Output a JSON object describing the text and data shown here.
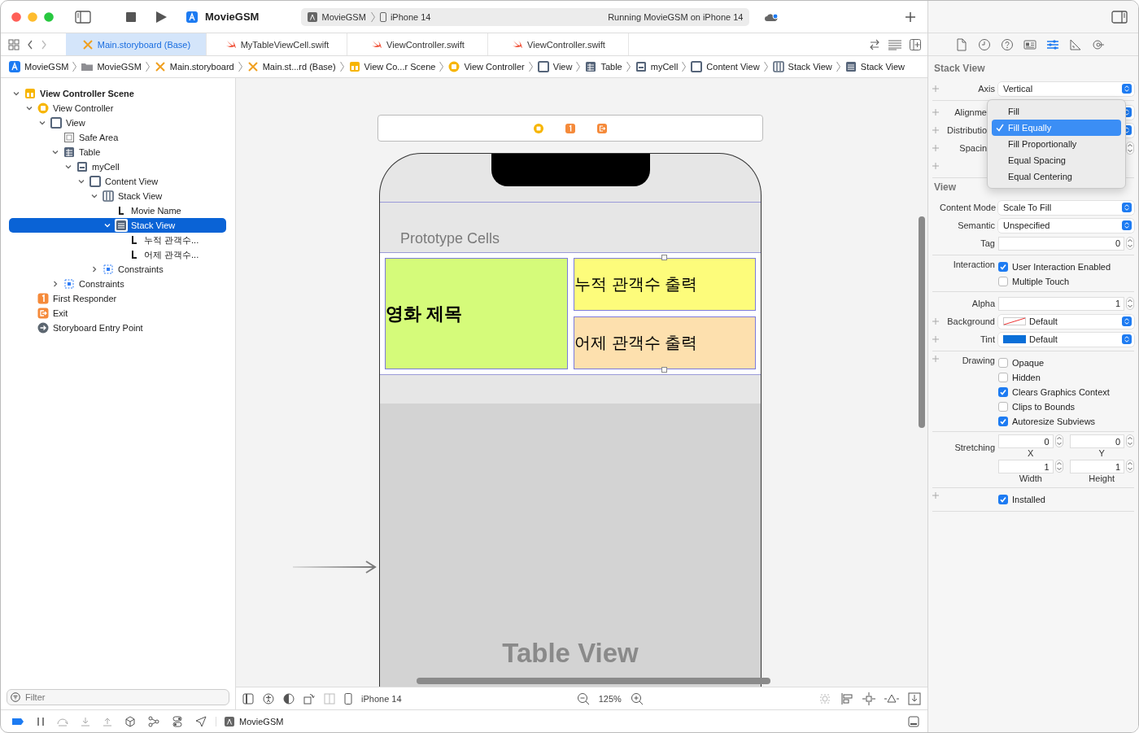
{
  "window": {
    "title": "MovieGSM"
  },
  "toolbar": {
    "scheme": "MovieGSM",
    "device": "iPhone 14",
    "status": "Running MovieGSM on iPhone 14"
  },
  "tabs": [
    {
      "label": "Main.storyboard (Base)",
      "kind": "storyboard",
      "selected": true
    },
    {
      "label": "MyTableViewCell.swift",
      "kind": "swift",
      "selected": false
    },
    {
      "label": "ViewController.swift",
      "kind": "swift",
      "selected": false
    },
    {
      "label": "ViewController.swift",
      "kind": "swift",
      "selected": false
    }
  ],
  "breadcrumbs": [
    {
      "label": "MovieGSM",
      "kind": "app"
    },
    {
      "label": "MovieGSM",
      "kind": "folder"
    },
    {
      "label": "Main.storyboard",
      "kind": "storyboard"
    },
    {
      "label": "Main.st...rd (Base)",
      "kind": "storyboard"
    },
    {
      "label": "View Co...r Scene",
      "kind": "scene"
    },
    {
      "label": "View Controller",
      "kind": "vc"
    },
    {
      "label": "View",
      "kind": "view"
    },
    {
      "label": "Table",
      "kind": "table"
    },
    {
      "label": "myCell",
      "kind": "cell"
    },
    {
      "label": "Content View",
      "kind": "view"
    },
    {
      "label": "Stack View",
      "kind": "stackh"
    },
    {
      "label": "Stack View",
      "kind": "stackv"
    }
  ],
  "outline": [
    {
      "label": "View Controller Scene",
      "kind": "scene",
      "expanded": true,
      "selected": false,
      "children": [
        {
          "label": "View Controller",
          "kind": "vc",
          "expanded": true,
          "selected": false,
          "children": [
            {
              "label": "View",
              "kind": "view",
              "expanded": true,
              "selected": false,
              "children": [
                {
                  "label": "Safe Area",
                  "kind": "safearea",
                  "selected": false
                },
                {
                  "label": "Table",
                  "kind": "table",
                  "expanded": true,
                  "selected": false,
                  "children": [
                    {
                      "label": "myCell",
                      "kind": "cell",
                      "expanded": true,
                      "selected": false,
                      "children": [
                        {
                          "label": "Content View",
                          "kind": "view",
                          "expanded": true,
                          "selected": false,
                          "children": [
                            {
                              "label": "Stack View",
                              "kind": "stackh",
                              "expanded": true,
                              "selected": false,
                              "children": [
                                {
                                  "label": "Movie Name",
                                  "kind": "label",
                                  "selected": false
                                },
                                {
                                  "label": "Stack View",
                                  "kind": "stackv",
                                  "expanded": true,
                                  "selected": true,
                                  "children": [
                                    {
                                      "label": "누적 관객수...",
                                      "kind": "label",
                                      "selected": false
                                    },
                                    {
                                      "label": "어제 관객수...",
                                      "kind": "label",
                                      "selected": false
                                    }
                                  ]
                                }
                              ]
                            },
                            {
                              "label": "Constraints",
                              "kind": "constraints",
                              "expanded": false,
                              "selected": false
                            }
                          ]
                        }
                      ]
                    }
                  ]
                },
                {
                  "label": "Constraints",
                  "kind": "constraints",
                  "expanded": false,
                  "selected": false
                }
              ]
            }
          ]
        },
        {
          "label": "First Responder",
          "kind": "responder",
          "selected": false
        },
        {
          "label": "Exit",
          "kind": "exit",
          "selected": false
        },
        {
          "label": "Storyboard Entry Point",
          "kind": "entry",
          "selected": false
        }
      ]
    }
  ],
  "filter": {
    "placeholder": "Filter"
  },
  "canvas": {
    "section_header": "Prototype Cells",
    "cell": {
      "title_label": "영화 제목",
      "total_label": "누적 관객수 출력",
      "yesterday_label": "어제 관객수 출력"
    },
    "table_label": "Table View"
  },
  "canvas_bar": {
    "device": "iPhone 14",
    "zoom": "125%"
  },
  "debug_bar": {
    "target": "MovieGSM"
  },
  "inspector_tabs": [
    {
      "kind": "file",
      "selected": false
    },
    {
      "kind": "history",
      "selected": false
    },
    {
      "kind": "help",
      "selected": false
    },
    {
      "kind": "identity",
      "selected": false
    },
    {
      "kind": "attributes",
      "selected": true
    },
    {
      "kind": "size",
      "selected": false
    },
    {
      "kind": "connections",
      "selected": false
    }
  ],
  "inspector": [
    {
      "title": "Stack View",
      "groups": [
        [
          {
            "kind": "popup",
            "label": "Axis",
            "value": "Vertical",
            "plus": true
          }
        ],
        [
          {
            "kind": "popup",
            "label": "Alignme",
            "plus": true,
            "covered": true
          },
          {
            "kind": "popup",
            "label": "Distributio",
            "plus": true,
            "covered": true
          },
          {
            "kind": "stepper",
            "label": "Spacin",
            "plus": true,
            "covered": true
          },
          {
            "kind": "blank",
            "plus": true
          }
        ]
      ]
    },
    {
      "title": "View",
      "groups": [
        [
          {
            "kind": "popup",
            "label": "Content Mode",
            "value": "Scale To Fill"
          },
          {
            "kind": "popup",
            "label": "Semantic",
            "value": "Unspecified"
          },
          {
            "kind": "stepper",
            "label": "Tag",
            "value": "0"
          }
        ],
        [
          {
            "kind": "checks",
            "label": "Interaction",
            "items": [
              {
                "label": "User Interaction Enabled",
                "checked": true
              },
              {
                "label": "Multiple Touch",
                "checked": false
              }
            ]
          }
        ],
        [
          {
            "kind": "stepper",
            "label": "Alpha",
            "value": "1"
          },
          {
            "kind": "color",
            "label": "Background",
            "value": "Default",
            "plus": true
          },
          {
            "kind": "color",
            "label": "Tint",
            "value": "Default",
            "color": "#0a6fd8",
            "plus": true
          }
        ],
        [
          {
            "kind": "checks",
            "label": "Drawing",
            "plus": true,
            "items": [
              {
                "label": "Opaque",
                "checked": false
              },
              {
                "label": "Hidden",
                "checked": false
              },
              {
                "label": "Clears Graphics Context",
                "checked": true
              },
              {
                "label": "Clips to Bounds",
                "checked": false
              },
              {
                "label": "Autoresize Subviews",
                "checked": true
              }
            ]
          }
        ],
        [
          {
            "kind": "pair",
            "label": "Stretching",
            "fields": [
              {
                "value": "0",
                "caption": "X"
              },
              {
                "value": "0",
                "caption": "Y"
              }
            ]
          },
          {
            "kind": "pair",
            "fields": [
              {
                "value": "1",
                "caption": "Width"
              },
              {
                "value": "1",
                "caption": "Height"
              }
            ]
          }
        ],
        [
          {
            "kind": "checks",
            "plus": true,
            "items": [
              {
                "label": "Installed",
                "checked": true
              }
            ]
          }
        ]
      ]
    }
  ],
  "popup_menu": {
    "items": [
      {
        "label": "Fill",
        "selected": false
      },
      {
        "label": "Fill Equally",
        "selected": true
      },
      {
        "label": "Fill Proportionally",
        "selected": false
      },
      {
        "label": "Equal Spacing",
        "selected": false
      },
      {
        "label": "Equal Centering",
        "selected": false
      }
    ]
  }
}
